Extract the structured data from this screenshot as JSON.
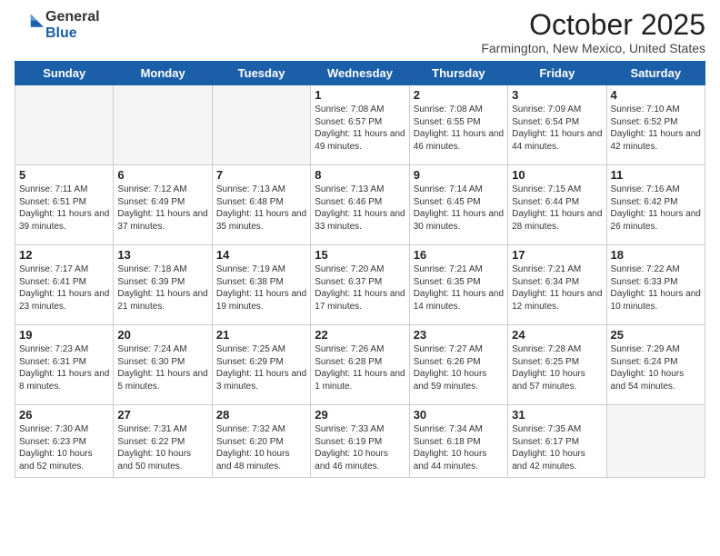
{
  "logo": {
    "general": "General",
    "blue": "Blue"
  },
  "header": {
    "month": "October 2025",
    "location": "Farmington, New Mexico, United States"
  },
  "weekdays": [
    "Sunday",
    "Monday",
    "Tuesday",
    "Wednesday",
    "Thursday",
    "Friday",
    "Saturday"
  ],
  "weeks": [
    [
      {
        "day": "",
        "info": ""
      },
      {
        "day": "",
        "info": ""
      },
      {
        "day": "",
        "info": ""
      },
      {
        "day": "1",
        "info": "Sunrise: 7:08 AM\nSunset: 6:57 PM\nDaylight: 11 hours and 49 minutes."
      },
      {
        "day": "2",
        "info": "Sunrise: 7:08 AM\nSunset: 6:55 PM\nDaylight: 11 hours and 46 minutes."
      },
      {
        "day": "3",
        "info": "Sunrise: 7:09 AM\nSunset: 6:54 PM\nDaylight: 11 hours and 44 minutes."
      },
      {
        "day": "4",
        "info": "Sunrise: 7:10 AM\nSunset: 6:52 PM\nDaylight: 11 hours and 42 minutes."
      }
    ],
    [
      {
        "day": "5",
        "info": "Sunrise: 7:11 AM\nSunset: 6:51 PM\nDaylight: 11 hours and 39 minutes."
      },
      {
        "day": "6",
        "info": "Sunrise: 7:12 AM\nSunset: 6:49 PM\nDaylight: 11 hours and 37 minutes."
      },
      {
        "day": "7",
        "info": "Sunrise: 7:13 AM\nSunset: 6:48 PM\nDaylight: 11 hours and 35 minutes."
      },
      {
        "day": "8",
        "info": "Sunrise: 7:13 AM\nSunset: 6:46 PM\nDaylight: 11 hours and 33 minutes."
      },
      {
        "day": "9",
        "info": "Sunrise: 7:14 AM\nSunset: 6:45 PM\nDaylight: 11 hours and 30 minutes."
      },
      {
        "day": "10",
        "info": "Sunrise: 7:15 AM\nSunset: 6:44 PM\nDaylight: 11 hours and 28 minutes."
      },
      {
        "day": "11",
        "info": "Sunrise: 7:16 AM\nSunset: 6:42 PM\nDaylight: 11 hours and 26 minutes."
      }
    ],
    [
      {
        "day": "12",
        "info": "Sunrise: 7:17 AM\nSunset: 6:41 PM\nDaylight: 11 hours and 23 minutes."
      },
      {
        "day": "13",
        "info": "Sunrise: 7:18 AM\nSunset: 6:39 PM\nDaylight: 11 hours and 21 minutes."
      },
      {
        "day": "14",
        "info": "Sunrise: 7:19 AM\nSunset: 6:38 PM\nDaylight: 11 hours and 19 minutes."
      },
      {
        "day": "15",
        "info": "Sunrise: 7:20 AM\nSunset: 6:37 PM\nDaylight: 11 hours and 17 minutes."
      },
      {
        "day": "16",
        "info": "Sunrise: 7:21 AM\nSunset: 6:35 PM\nDaylight: 11 hours and 14 minutes."
      },
      {
        "day": "17",
        "info": "Sunrise: 7:21 AM\nSunset: 6:34 PM\nDaylight: 11 hours and 12 minutes."
      },
      {
        "day": "18",
        "info": "Sunrise: 7:22 AM\nSunset: 6:33 PM\nDaylight: 11 hours and 10 minutes."
      }
    ],
    [
      {
        "day": "19",
        "info": "Sunrise: 7:23 AM\nSunset: 6:31 PM\nDaylight: 11 hours and 8 minutes."
      },
      {
        "day": "20",
        "info": "Sunrise: 7:24 AM\nSunset: 6:30 PM\nDaylight: 11 hours and 5 minutes."
      },
      {
        "day": "21",
        "info": "Sunrise: 7:25 AM\nSunset: 6:29 PM\nDaylight: 11 hours and 3 minutes."
      },
      {
        "day": "22",
        "info": "Sunrise: 7:26 AM\nSunset: 6:28 PM\nDaylight: 11 hours and 1 minute."
      },
      {
        "day": "23",
        "info": "Sunrise: 7:27 AM\nSunset: 6:26 PM\nDaylight: 10 hours and 59 minutes."
      },
      {
        "day": "24",
        "info": "Sunrise: 7:28 AM\nSunset: 6:25 PM\nDaylight: 10 hours and 57 minutes."
      },
      {
        "day": "25",
        "info": "Sunrise: 7:29 AM\nSunset: 6:24 PM\nDaylight: 10 hours and 54 minutes."
      }
    ],
    [
      {
        "day": "26",
        "info": "Sunrise: 7:30 AM\nSunset: 6:23 PM\nDaylight: 10 hours and 52 minutes."
      },
      {
        "day": "27",
        "info": "Sunrise: 7:31 AM\nSunset: 6:22 PM\nDaylight: 10 hours and 50 minutes."
      },
      {
        "day": "28",
        "info": "Sunrise: 7:32 AM\nSunset: 6:20 PM\nDaylight: 10 hours and 48 minutes."
      },
      {
        "day": "29",
        "info": "Sunrise: 7:33 AM\nSunset: 6:19 PM\nDaylight: 10 hours and 46 minutes."
      },
      {
        "day": "30",
        "info": "Sunrise: 7:34 AM\nSunset: 6:18 PM\nDaylight: 10 hours and 44 minutes."
      },
      {
        "day": "31",
        "info": "Sunrise: 7:35 AM\nSunset: 6:17 PM\nDaylight: 10 hours and 42 minutes."
      },
      {
        "day": "",
        "info": ""
      }
    ]
  ]
}
